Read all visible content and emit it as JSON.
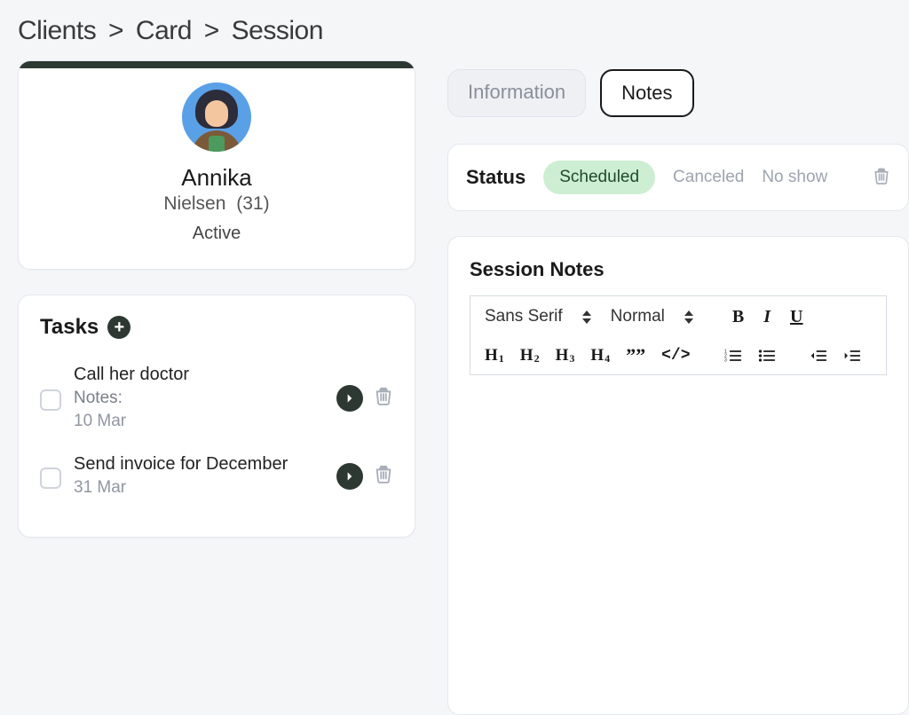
{
  "breadcrumb": {
    "a": "Clients",
    "b": "Card",
    "c": "Session"
  },
  "client": {
    "first_name": "Annika",
    "last_name": "Nielsen",
    "age_display": "(31)",
    "status": "Active"
  },
  "tasks": {
    "title": "Tasks",
    "items": [
      {
        "title": "Call her doctor",
        "notes_label": "Notes:",
        "date": "10 Mar"
      },
      {
        "title": "Send invoice for December",
        "notes_label": "",
        "date": "31 Mar"
      }
    ]
  },
  "tabs": {
    "information": "Information",
    "notes": "Notes"
  },
  "status_bar": {
    "label": "Status",
    "selected": "Scheduled",
    "canceled": "Canceled",
    "no_show": "No show"
  },
  "editor": {
    "title": "Session Notes",
    "font_select": "Sans Serif",
    "size_select": "Normal",
    "h1": "H",
    "h2": "H",
    "h3": "H",
    "h4": "H",
    "sub1": "1",
    "sub2": "2",
    "sub3": "3",
    "sub4": "4",
    "bold": "B",
    "italic": "I",
    "underline": "U",
    "quote": "””",
    "code": "</>"
  }
}
